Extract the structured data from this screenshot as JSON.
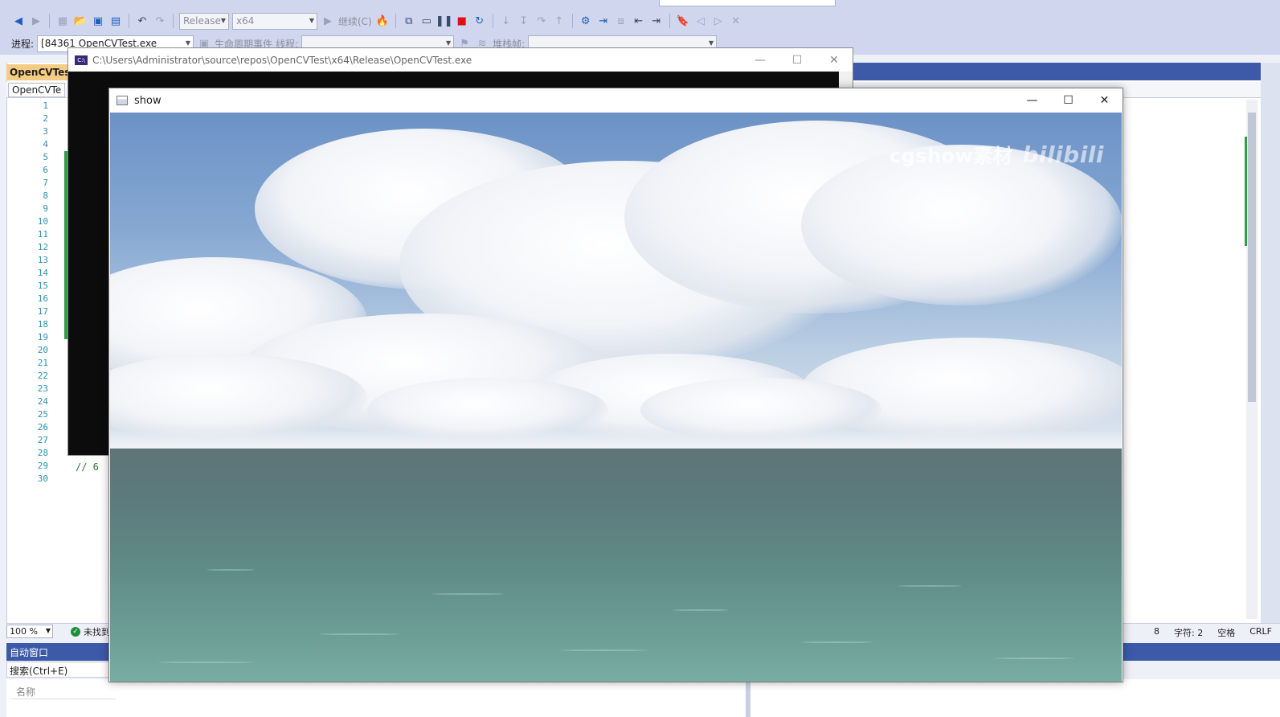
{
  "toolbar": {
    "config": "Release",
    "platform": "x64",
    "continue_label": "继续(C)",
    "process_label": "进程:",
    "process_value": "[84361 OpenCVTest.exe",
    "lifecycle_label": "生命周期事件",
    "thread_label": "线程:",
    "stackframe_label": "堆栈帧:"
  },
  "editor": {
    "tab_title": "OpenCVTest",
    "nav_left": "OpenCVTe",
    "line_numbers": [
      "1",
      "2",
      "3",
      "4",
      "5",
      "6",
      "7",
      "8",
      "9",
      "10",
      "11",
      "12",
      "13",
      "14",
      "15",
      "16",
      "17",
      "18",
      "19",
      "20",
      "21",
      "22",
      "23",
      "24",
      "25",
      "26",
      "27",
      "28",
      "29",
      "30"
    ],
    "code_peek": "//   6"
  },
  "status": {
    "zoom": "100 %",
    "issues": "未找到",
    "line": "8",
    "char": "字符: 2",
    "spacing": "空格",
    "eol": "CRLF"
  },
  "auto_window": {
    "title": "自动窗口",
    "search_placeholder": "搜索(Ctrl+E)",
    "col_name": "名称"
  },
  "console": {
    "path": "C:\\Users\\Administrator\\source\\repos\\OpenCVTest\\x64\\Release\\OpenCVTest.exe"
  },
  "show_window": {
    "title": "show",
    "watermark": "cgshow素材",
    "watermark_logo": "bilibili"
  },
  "colors": {
    "toolbar_bg": "#cfd6ee",
    "accent_blue": "#3c5aa8",
    "tab_active": "#f5cc84",
    "change_green": "#2f9e44"
  }
}
